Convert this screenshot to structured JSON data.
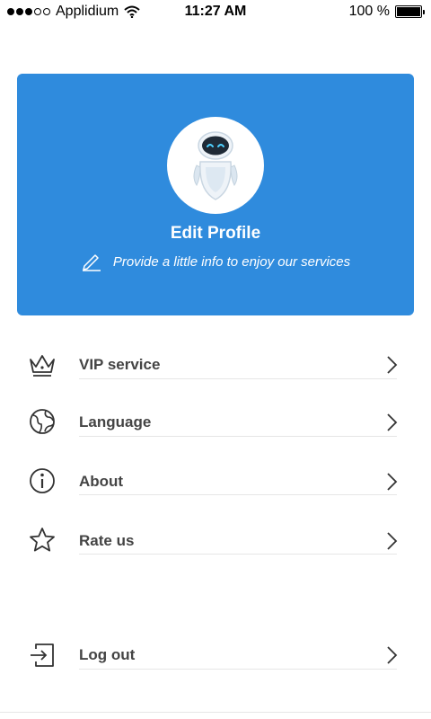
{
  "status_bar": {
    "carrier": "Applidium",
    "time": "11:27 AM",
    "battery": "100 %"
  },
  "profile": {
    "title": "Edit Profile",
    "subtitle": "Provide a little info to enjoy our services"
  },
  "menu": [
    {
      "label": "VIP service",
      "icon": "crown-icon"
    },
    {
      "label": "Language",
      "icon": "globe-icon"
    },
    {
      "label": "About",
      "icon": "info-icon"
    },
    {
      "label": "Rate us",
      "icon": "star-icon"
    },
    {
      "label": "Log out",
      "icon": "logout-icon"
    }
  ],
  "colors": {
    "accent": "#2f8bdd",
    "text": "#444444",
    "divider": "#e6e6e6"
  }
}
